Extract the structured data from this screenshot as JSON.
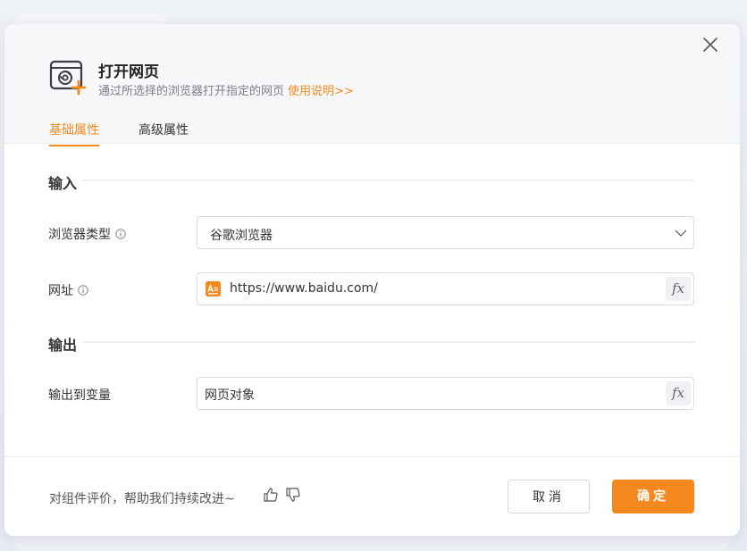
{
  "dialog": {
    "title": "打开网页",
    "description": "通过所选择的浏览器打开指定的网页",
    "help_link": "使用说明>>",
    "icon": "browser-open-plus-icon"
  },
  "tabs": [
    {
      "label": "基础属性",
      "active": true
    },
    {
      "label": "高级属性",
      "active": false
    }
  ],
  "input_section": {
    "title": "输入",
    "browser_type": {
      "label": "浏览器类型",
      "value": "谷歌浏览器"
    },
    "url": {
      "label": "网址",
      "value": "https://www.baidu.com/"
    }
  },
  "output_section": {
    "title": "输出",
    "output_var": {
      "label": "输出到变量",
      "value": "网页对象"
    }
  },
  "fx_label": "fx",
  "footer": {
    "feedback": "对组件评价，帮助我们持续改进~",
    "cancel": "取消",
    "ok": "确定"
  },
  "colors": {
    "accent": "#f5891f",
    "text": "#333333",
    "muted": "#7a7f88"
  }
}
